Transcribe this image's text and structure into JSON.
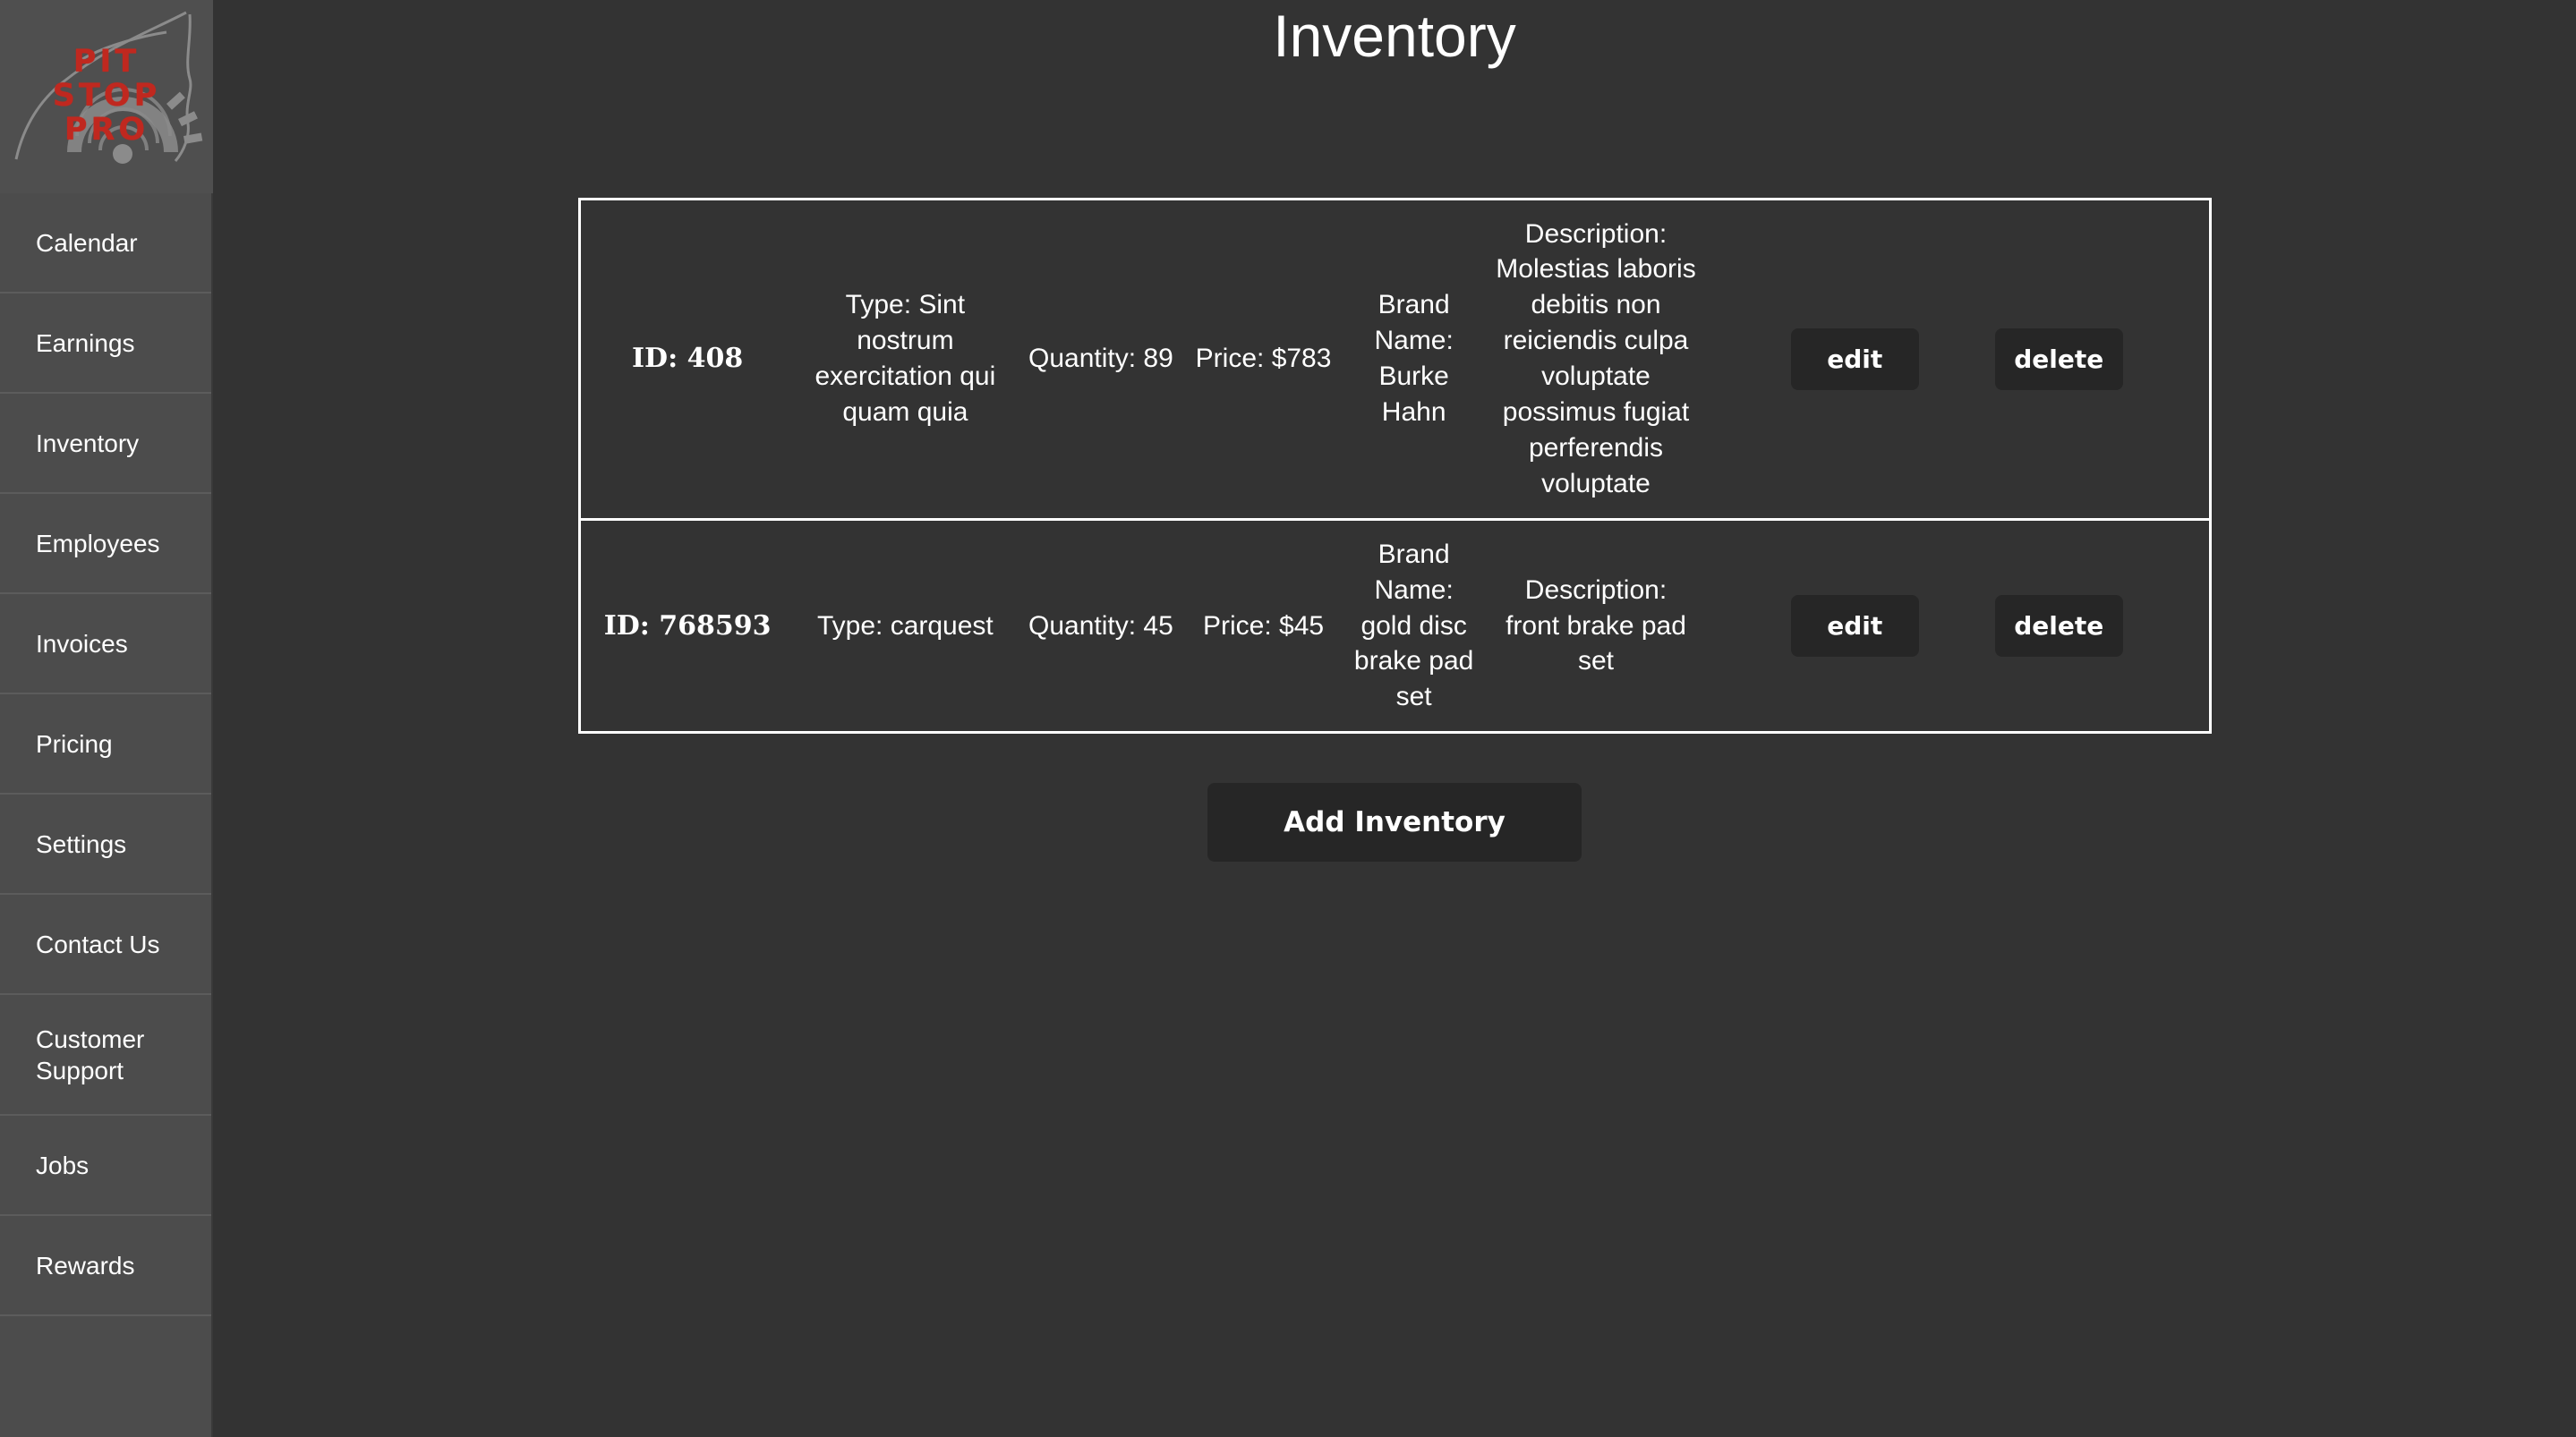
{
  "sidebar": {
    "logo": {
      "line1": "PIT",
      "line2": "STOP",
      "line3": "PRO",
      "brand_color": "#c0281f"
    },
    "items": [
      {
        "label": "Calendar"
      },
      {
        "label": "Earnings"
      },
      {
        "label": "Inventory"
      },
      {
        "label": "Employees"
      },
      {
        "label": "Invoices"
      },
      {
        "label": "Pricing"
      },
      {
        "label": "Settings"
      },
      {
        "label": "Contact Us"
      },
      {
        "label": "Customer Support"
      },
      {
        "label": "Jobs"
      },
      {
        "label": "Rewards"
      }
    ]
  },
  "main": {
    "page_title": "Inventory",
    "add_button_label": "Add Inventory",
    "row_actions": {
      "edit_label": "edit",
      "delete_label": "delete"
    },
    "rows": [
      {
        "id": "ID: 408",
        "type": "Type: Sint nostrum exercitation qui quam quia",
        "quantity": "Quantity: 89",
        "price": "Price: $783",
        "brand": "Brand Name: Burke Hahn",
        "description": "Description: Molestias laboris debitis non reiciendis culpa voluptate possimus fugiat perferendis voluptate"
      },
      {
        "id": "ID: 768593",
        "type": "Type: carquest",
        "quantity": "Quantity: 45",
        "price": "Price: $45",
        "brand": "Brand Name: gold disc brake pad set",
        "description": "Description: front brake pad set"
      }
    ]
  },
  "colors": {
    "page_background": "#333333",
    "sidebar_background": "#4c4c4c",
    "table_border": "#ffffff",
    "button_background": "#262626",
    "text": "#ffffff"
  }
}
